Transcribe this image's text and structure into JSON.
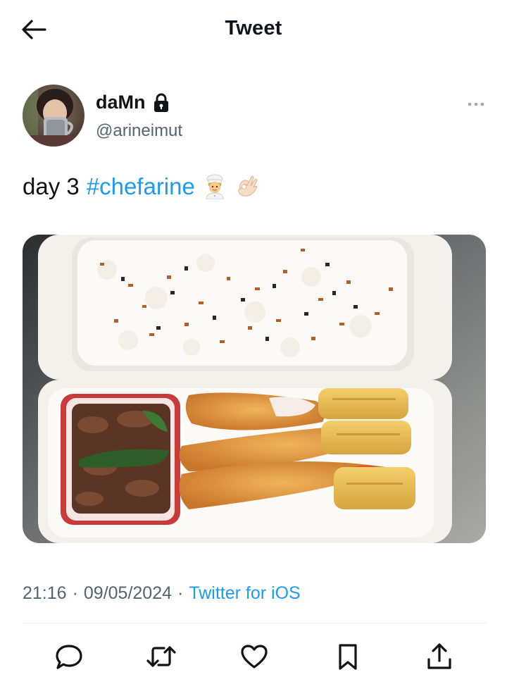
{
  "header": {
    "title": "Tweet",
    "back_icon": "arrow-left-icon"
  },
  "author": {
    "display_name": "daMn",
    "handle": "@arineimut",
    "protected_icon": "lock-icon",
    "more_icon": "more-horizontal-icon"
  },
  "tweet": {
    "text": "day 3",
    "hashtag": "#chefarine",
    "emojis": [
      "woman-cook-emoji",
      "ok-hand-emoji"
    ]
  },
  "media": {
    "kind": "photo",
    "subject": "bento-boxes-rice-fried-shrimp"
  },
  "meta": {
    "time": "21:16",
    "sep1": "·",
    "date": "09/05/2024",
    "sep2": "·",
    "source": "Twitter for iOS"
  },
  "actions": [
    {
      "name": "reply-icon"
    },
    {
      "name": "retweet-icon"
    },
    {
      "name": "like-icon"
    },
    {
      "name": "bookmark-icon"
    },
    {
      "name": "share-icon"
    }
  ],
  "colors": {
    "accent": "#1d9bf0",
    "text_primary": "#0f1419",
    "text_secondary": "#536471",
    "divider": "#eff3f4"
  }
}
